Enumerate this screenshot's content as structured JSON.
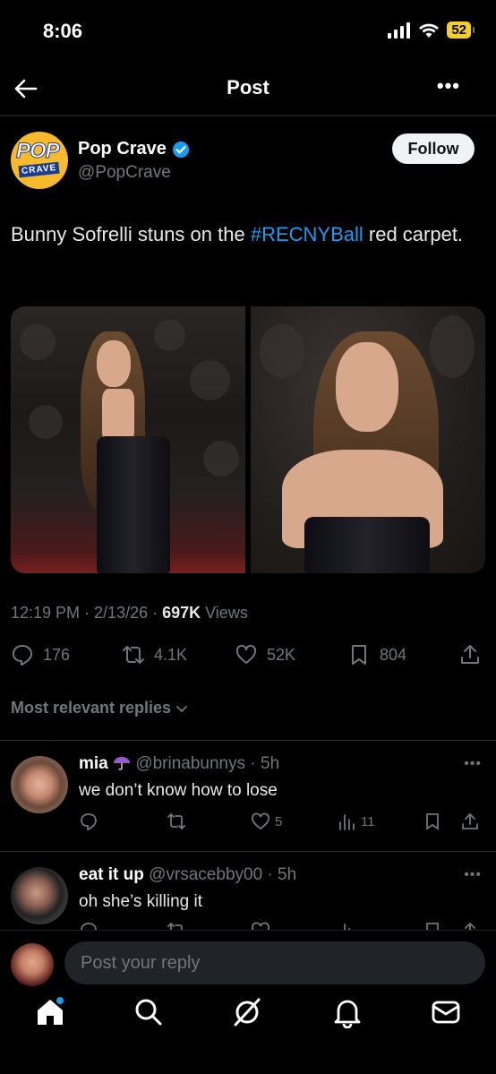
{
  "status": {
    "time": "8:06",
    "battery": "52"
  },
  "nav": {
    "title": "Post",
    "more": "•••"
  },
  "author": {
    "name": "Pop Crave",
    "handle": "@PopCrave",
    "logo_top": "POP",
    "logo_bottom": "CRAVE",
    "follow_label": "Follow"
  },
  "post": {
    "text_before": "Bunny Sofrelli stuns on the ",
    "hashtag": "#RECNYBall",
    "text_after": " red carpet."
  },
  "meta": {
    "time_date": "12:19 PM · 2/13/26 · ",
    "views_count": "697K",
    "views_label": " Views"
  },
  "actions": {
    "replies": "176",
    "reposts": "4.1K",
    "likes": "52K",
    "bookmarks": "804"
  },
  "replies_header": "Most relevant replies",
  "replies": [
    {
      "name": "mia",
      "handle": "@brinabunnys · 5h",
      "text": "we don’t know how to lose",
      "likes": "5",
      "views": "11",
      "dots": "•••"
    },
    {
      "name": "eat it up",
      "handle": "@vrsacebby00 · 5h",
      "text": "oh she’s killing it",
      "dots": "•••"
    }
  ],
  "composer": {
    "placeholder": "Post your reply"
  },
  "colors": {
    "accent": "#1d9bf0",
    "background": "#000000",
    "muted": "#71767b",
    "battery": "#f2d02c",
    "logo": "#f6ba2c"
  }
}
